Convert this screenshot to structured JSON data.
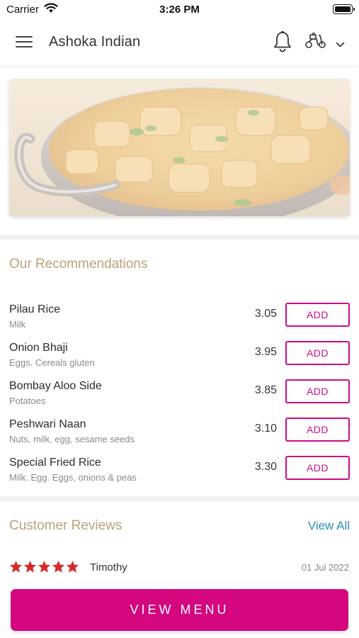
{
  "status_bar": {
    "carrier": "Carrier",
    "time": "3:26 PM"
  },
  "header": {
    "title": "Ashoka Indian",
    "icons": [
      "menu-icon",
      "bell-icon",
      "scooter-icon",
      "chevron-down-icon"
    ]
  },
  "recommendations": {
    "title": "Our Recommendations",
    "add_label": "ADD",
    "items": [
      {
        "name": "Pilau Rice",
        "desc": "Milk",
        "price": "3.05"
      },
      {
        "name": "Onion Bhaji",
        "desc": "Eggs. Cereals gluten",
        "price": "3.95"
      },
      {
        "name": "Bombay Aloo Side",
        "desc": "Potatoes",
        "price": "3.85"
      },
      {
        "name": "Peshwari Naan",
        "desc": "Nuts, milk, egg, sesame seeds",
        "price": "3.10"
      },
      {
        "name": "Special Fried Rice",
        "desc": "Milk. Egg. Eggs, onions & peas",
        "price": "3.30"
      }
    ]
  },
  "reviews": {
    "title": "Customer Reviews",
    "view_all": "View All",
    "items": [
      {
        "rating": 5,
        "name": "Timothy",
        "date": "01 Jul 2022"
      }
    ]
  },
  "cta": {
    "label": "VIEW MENU"
  },
  "colors": {
    "accent": "#d4077f",
    "section_title": "#b9a27a",
    "link": "#2a8fb5",
    "star": "#d72a2a"
  }
}
